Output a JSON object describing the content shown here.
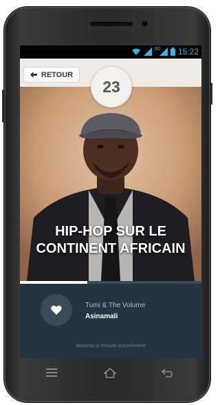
{
  "status_bar": {
    "time": "15:22",
    "network": "3G",
    "icons": [
      "wifi-icon",
      "signal-icon",
      "signal-3g-icon",
      "battery-icon"
    ]
  },
  "header": {
    "back_label": "RETOUR",
    "back_icon": "arrow-left-icon",
    "track_number": "23"
  },
  "artwork": {
    "title_line1": "HIP-HOP SUR LE",
    "title_line2": "CONTINENT AFRICAIN"
  },
  "progress": {
    "fraction": 0.37
  },
  "player": {
    "artist": "Tumi & The Volume",
    "track": "Asinamali",
    "status": "Morceau à l'écoute actuellement",
    "like_icon": "heart-icon"
  },
  "nav_bar": {
    "icons": [
      "menu-icon",
      "home-icon",
      "back-icon"
    ]
  },
  "colors": {
    "accent": "#33b5e5",
    "player_bg": "#243542",
    "header_bg": "#efece7",
    "progress": "#ffffff"
  }
}
